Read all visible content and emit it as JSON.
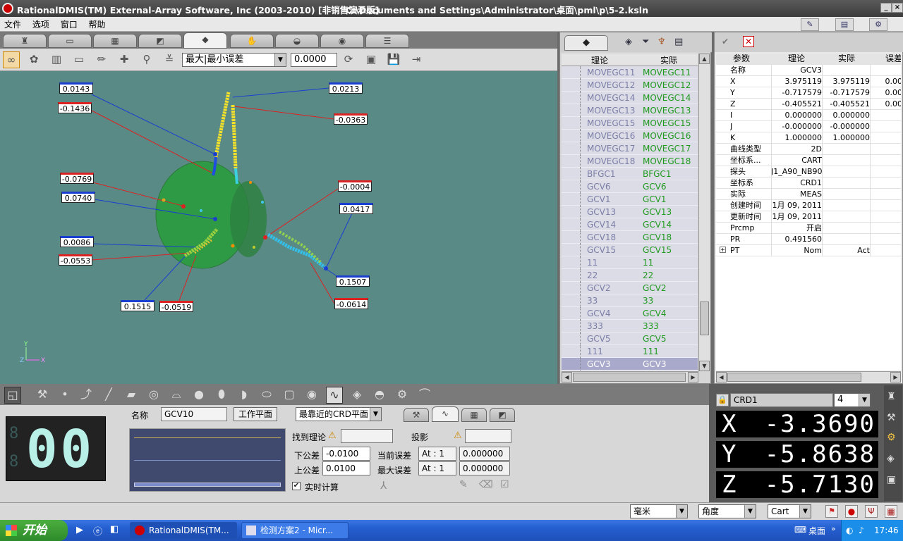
{
  "window": {
    "title": "RationalDMIS(TM) External-Array Software, Inc (2003-2010) [非销售演示版]",
    "path": "C:\\Documents and Settings\\Administrator\\桌面\\pml\\p\\5-2.ksln"
  },
  "menu": [
    "文件",
    "选项",
    "窗口",
    "帮助"
  ],
  "toolbar": {
    "fit_mode": "最大|最小误差",
    "value": "0.0000"
  },
  "labels": {
    "blue": [
      {
        "t": "0.0143"
      },
      {
        "t": "0.0213"
      },
      {
        "t": "0.0740"
      },
      {
        "t": "0.0417"
      },
      {
        "t": "0.0086"
      },
      {
        "t": "0.1507"
      },
      {
        "t": "0.1515"
      }
    ],
    "red": [
      {
        "t": "-0.1436"
      },
      {
        "t": "-0.0363"
      },
      {
        "t": "-0.0769"
      },
      {
        "t": "-0.0004"
      },
      {
        "t": "-0.0553"
      },
      {
        "t": "-0.0519"
      },
      {
        "t": "-0.0614"
      }
    ]
  },
  "feature_list": {
    "col_nominal": "理论",
    "col_actual": "实际",
    "rows": [
      [
        "MOVEGC11",
        "MOVEGC11"
      ],
      [
        "MOVEGC12",
        "MOVEGC12"
      ],
      [
        "MOVEGC14",
        "MOVEGC14"
      ],
      [
        "MOVEGC13",
        "MOVEGC13"
      ],
      [
        "MOVEGC15",
        "MOVEGC15"
      ],
      [
        "MOVEGC16",
        "MOVEGC16"
      ],
      [
        "MOVEGC17",
        "MOVEGC17"
      ],
      [
        "MOVEGC18",
        "MOVEGC18"
      ],
      [
        "BFGC1",
        "BFGC1"
      ],
      [
        "GCV6",
        "GCV6"
      ],
      [
        "GCV1",
        "GCV1"
      ],
      [
        "GCV13",
        "GCV13"
      ],
      [
        "GCV14",
        "GCV14"
      ],
      [
        "GCV18",
        "GCV18"
      ],
      [
        "GCV15",
        "GCV15"
      ],
      [
        "11",
        "11"
      ],
      [
        "22",
        "22"
      ],
      [
        "GCV2",
        "GCV2"
      ],
      [
        "33",
        "33"
      ],
      [
        "GCV4",
        "GCV4"
      ],
      [
        "333",
        "333"
      ],
      [
        "GCV5",
        "GCV5"
      ],
      [
        "111",
        "111"
      ],
      [
        "GCV3",
        "GCV3"
      ]
    ]
  },
  "props": {
    "headers": [
      "参数",
      "理论",
      "实际",
      "误差"
    ],
    "rows": [
      [
        "名称",
        "GCV3",
        "",
        ""
      ],
      [
        "X",
        "3.975119",
        "3.975119",
        "0.00"
      ],
      [
        "Y",
        "-0.717579",
        "-0.717579",
        "0.00"
      ],
      [
        "Z",
        "-0.405521",
        "-0.405521",
        "0.00"
      ],
      [
        "I",
        "0.000000",
        "0.000000",
        ""
      ],
      [
        "J",
        "-0.000000",
        "-0.000000",
        ""
      ],
      [
        "K",
        "1.000000",
        "1.000000",
        ""
      ],
      [
        "曲线类型",
        "2D",
        "",
        ""
      ],
      [
        "坐标系...",
        "CART",
        "",
        ""
      ],
      [
        "探头",
        "J1_A90_NB90",
        "",
        ""
      ],
      [
        "坐标系",
        "CRD1",
        "",
        ""
      ],
      [
        "实际",
        "MEAS",
        "",
        ""
      ],
      [
        "创建时间",
        "1月 09, 2011",
        "",
        ""
      ],
      [
        "更新时间",
        "1月 09, 2011",
        "",
        ""
      ],
      [
        "Prcmp",
        "开启",
        "",
        ""
      ],
      [
        "PR",
        "0.491560",
        "",
        ""
      ],
      [
        "PT",
        "Nom",
        "Act",
        ""
      ]
    ]
  },
  "bottom": {
    "digits": "00",
    "name_label": "名称",
    "name_value": "GCV10",
    "workplane_btn": "工作平面",
    "crd_select": "最靠近的CRD平面",
    "find_nominal": "找到理论",
    "projection": "投影",
    "lower_tol_label": "下公差",
    "lower_tol": "-0.0100",
    "upper_tol_label": "上公差",
    "upper_tol": "0.0100",
    "current_err_label": "当前误差",
    "current_at": "At : 1",
    "current_err": "0.000000",
    "max_err_label": "最大误差",
    "max_at": "At : 1",
    "max_err": "0.000000",
    "realtime": "实时计算"
  },
  "readout": {
    "crd": "CRD1",
    "digits": "4",
    "X": "-3.3690",
    "Y": "-5.8638",
    "Z": "-5.7130"
  },
  "status": {
    "units": "毫米",
    "angle": "角度",
    "coord": "Cart"
  },
  "taskbar": {
    "start": "开始",
    "task1": "RationalDMIS(TM...",
    "task2": "检测方案2 - Micr...",
    "tray_text": "桌面",
    "time": "17:46"
  }
}
